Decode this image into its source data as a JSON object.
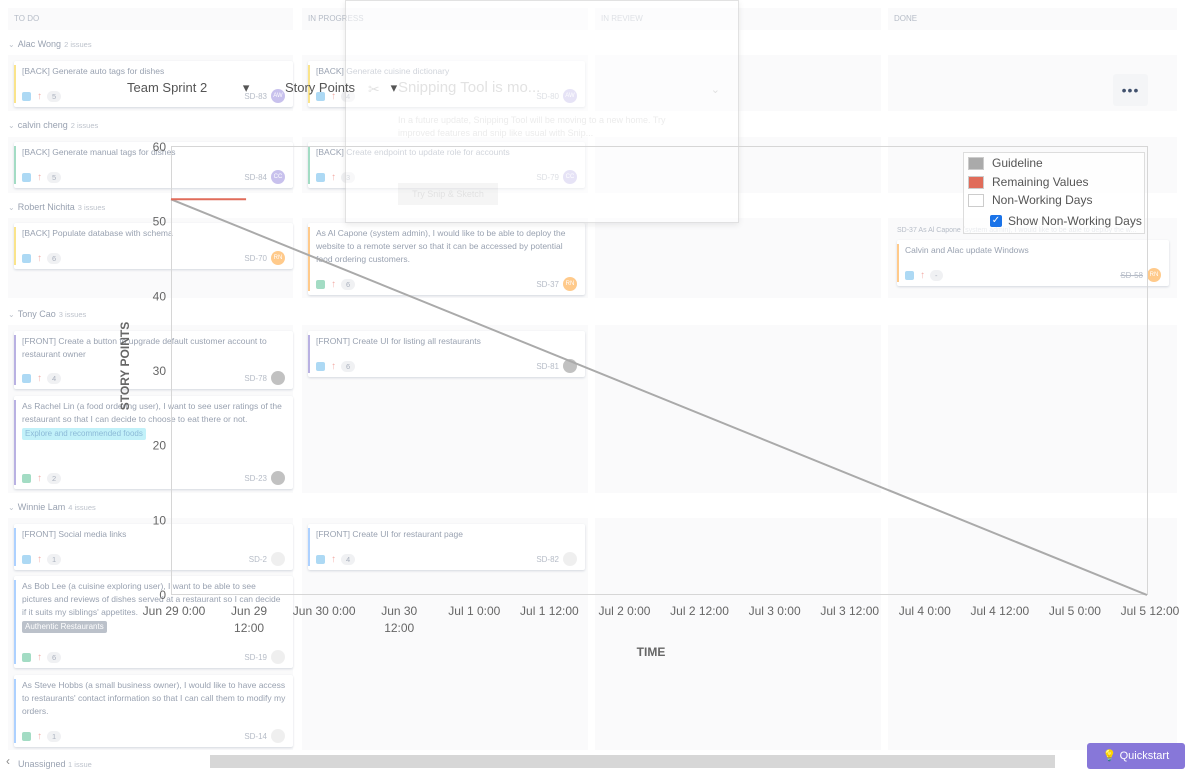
{
  "board": {
    "columns": [
      "TO DO",
      "IN PROGRESS",
      "IN REVIEW",
      "DONE"
    ],
    "lanes": [
      {
        "name": "Alac Wong",
        "count": "2 issues"
      },
      {
        "name": "calvin cheng",
        "count": "2 issues"
      },
      {
        "name": "Robert Nichita",
        "count": "3 issues"
      },
      {
        "name": "Tony Cao",
        "count": "3 issues"
      },
      {
        "name": "Winnie Lam",
        "count": "4 issues"
      }
    ],
    "unassigned": {
      "name": "Unassigned",
      "count": "1 issue"
    },
    "cards": [
      {
        "title": "[BACK] Generate auto tags for dishes",
        "points": "5",
        "key": "SD-83",
        "avatar": "AW",
        "bar": "#f5c400",
        "avatarColor": "#8777d9"
      },
      {
        "title": "[BACK] Generate cuisine dictionary",
        "points": "4",
        "key": "SD-80",
        "avatar": "AW",
        "bar": "#f5c400",
        "avatarColor": "#8777d9"
      },
      {
        "title": "[BACK] Generate manual tags for dishes",
        "points": "5",
        "key": "SD-84",
        "avatar": "CC",
        "bar": "#36b37e",
        "avatarColor": "#8777d9"
      },
      {
        "title": "[BACK] Create endpoint to update role for accounts",
        "points": "3",
        "key": "SD-79",
        "avatar": "CC",
        "bar": "#36b37e",
        "avatarColor": "#8777d9"
      },
      {
        "title": "[BACK] Populate database with schema",
        "points": "6",
        "key": "SD-70",
        "avatar": "RN",
        "bar": "#f5c400",
        "avatarColor": "#ff8b00"
      },
      {
        "title": "As Al Capone (system admin), I would like to be able to deploy the website to a remote server so that it can be accessed by potential food ordering customers.",
        "points": "6",
        "key": "SD-37",
        "avatar": "RN",
        "bar": "#ff8b00",
        "avatarColor": "#ff8b00"
      },
      {
        "title": "[FRONT] Create a button to upgrade default customer account to restaurant owner",
        "points": "4",
        "key": "SD-78",
        "avatar": "",
        "bar": "#6554c0",
        "avatarColor": "#777"
      },
      {
        "title": "[FRONT] Create UI for listing all restaurants",
        "points": "6",
        "key": "SD-81",
        "avatar": "",
        "bar": "#6554c0",
        "avatarColor": "#777"
      },
      {
        "title": "As Rachel Lin (a food ordering user), I want to see user ratings of the restaurant so that I can decide to choose to eat there or not.",
        "points": "2",
        "key": "SD-23",
        "avatar": "",
        "bar": "#6554c0",
        "avatarColor": "#777",
        "epic": "Explore and recommended foods"
      },
      {
        "title": "[FRONT] Social media links",
        "points": "1",
        "key": "SD-2",
        "avatar": "",
        "bar": "#4c9aff",
        "avatarColor": "#ddd"
      },
      {
        "title": "[FRONT] Create UI for restaurant page",
        "points": "4",
        "key": "SD-82",
        "avatar": "",
        "bar": "#4c9aff",
        "avatarColor": "#ddd"
      },
      {
        "title": "As Bob Lee (a cuisine exploring user), I want to be able to see pictures and reviews of dishes served at a restaurant so I can decide if it suits my siblings' appetites.",
        "points": "6",
        "key": "SD-19",
        "avatar": "",
        "bar": "#4c9aff",
        "avatarColor": "#ddd",
        "epic": "Authentic Restaurants"
      },
      {
        "title": "As Steve Hobbs (a small business owner), I would like to have access to restaurants' contact information so that I can call them to modify my orders.",
        "points": "1",
        "key": "SD-14",
        "avatar": "",
        "bar": "#4c9aff",
        "avatarColor": "#ddd"
      },
      {
        "title": "Calvin and Alac update Windows",
        "points": "-",
        "key": "SD-58",
        "avatar": "RN",
        "bar": "#ff8b00",
        "avatarColor": "#ff8b00",
        "parent": "SD-37 As Al Capone (system admin), I would like to be able to deploy the w..."
      }
    ]
  },
  "dialog": {
    "title": "Snipping Tool is mo...",
    "text": "In a future update, Snipping Tool will be moving to a new home. Try improved features and snip like usual with Snip...",
    "button": "Try Snip & Sketch"
  },
  "chart_controls": {
    "sprint": "Team Sprint 2",
    "metric": "Story Points"
  },
  "chart_data": {
    "type": "line",
    "xlabel": "TIME",
    "ylabel": "STORY POINTS",
    "ylim": [
      0,
      60
    ],
    "yticks": [
      "60",
      "50",
      "40",
      "30",
      "20",
      "10",
      "0"
    ],
    "xticks": [
      [
        "Jun 29 0:00"
      ],
      [
        "Jun 29",
        "12:00"
      ],
      [
        "Jun 30 0:00"
      ],
      [
        "Jun 30",
        "12:00"
      ],
      [
        "Jul 1 0:00"
      ],
      [
        "Jul 1 12:00"
      ],
      [
        "Jul 2 0:00"
      ],
      [
        "Jul 2 12:00"
      ],
      [
        "Jul 3 0:00"
      ],
      [
        "Jul 3 12:00"
      ],
      [
        "Jul 4 0:00"
      ],
      [
        "Jul 4 12:00"
      ],
      [
        "Jul 5 0:00"
      ],
      [
        "Jul 5 12:00"
      ]
    ],
    "series": [
      {
        "name": "Guideline",
        "color": "#aaaaaa",
        "x": [
          "Jun 29 0:00",
          "Jul 5 12:00"
        ],
        "y": [
          53,
          0
        ]
      },
      {
        "name": "Remaining Values",
        "color": "#e06c5a",
        "x": [
          "Jun 29 0:00",
          "Jun 29 12:00"
        ],
        "y": [
          53,
          53
        ]
      }
    ],
    "legend": {
      "items": [
        {
          "label": "Guideline",
          "color": "#aaaaaa"
        },
        {
          "label": "Remaining Values",
          "color": "#e06c5a"
        },
        {
          "label": "Non-Working Days",
          "color": "#ffffff"
        }
      ],
      "toggle": "Show Non-Working Days",
      "placement": "top-right"
    }
  },
  "ui": {
    "more": "•••",
    "quickstart": "Quickstart",
    "scroll_left": "‹"
  }
}
